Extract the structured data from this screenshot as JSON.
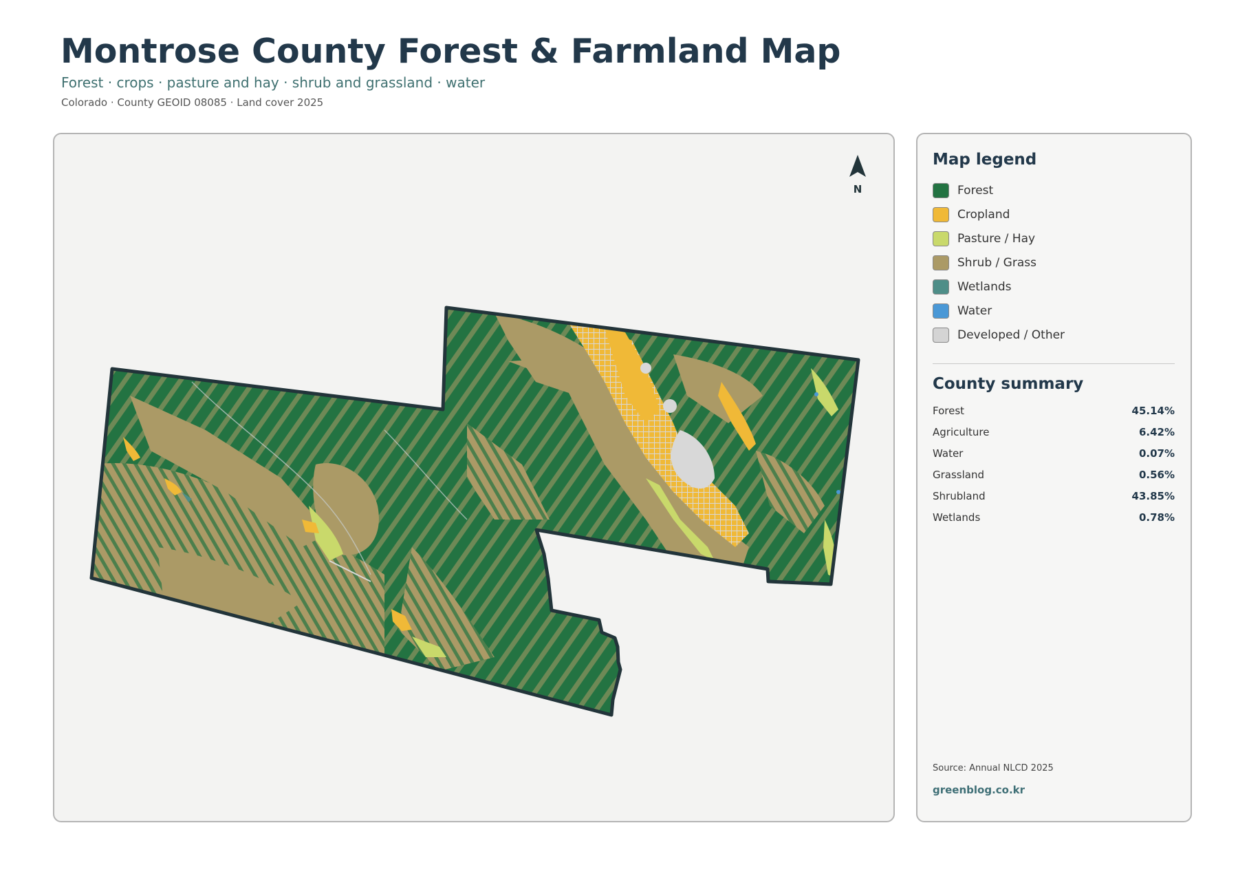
{
  "header": {
    "title": "Montrose County Forest & Farmland Map",
    "subtitle": "Forest · crops · pasture and hay · shrub and grassland · water",
    "meta": "Colorado · County GEOID 08085 · Land cover 2025"
  },
  "map": {
    "north_label": "N",
    "colors": {
      "forest": "#237342",
      "cropland": "#f0b937",
      "pasture": "#c9d96b",
      "shrub": "#ab9a66",
      "wetlands": "#4e8e88",
      "water": "#4a98d6",
      "developed": "#d8d8d8",
      "outline": "#22343a"
    }
  },
  "legend": {
    "title": "Map legend",
    "items": [
      {
        "label": "Forest",
        "color": "#237342"
      },
      {
        "label": "Cropland",
        "color": "#f0b937"
      },
      {
        "label": "Pasture / Hay",
        "color": "#c9d96b"
      },
      {
        "label": "Shrub / Grass",
        "color": "#ab9a66"
      },
      {
        "label": "Wetlands",
        "color": "#4e8e88"
      },
      {
        "label": "Water",
        "color": "#4a98d6"
      },
      {
        "label": "Developed / Other",
        "color": "#d4d4d4"
      }
    ]
  },
  "summary": {
    "title": "County summary",
    "rows": [
      {
        "name": "Forest",
        "value": "45.14%"
      },
      {
        "name": "Agriculture",
        "value": "6.42%"
      },
      {
        "name": "Water",
        "value": "0.07%"
      },
      {
        "name": "Grassland",
        "value": "0.56%"
      },
      {
        "name": "Shrubland",
        "value": "43.85%"
      },
      {
        "name": "Wetlands",
        "value": "0.78%"
      }
    ]
  },
  "footer": {
    "source": "Source: Annual NLCD 2025",
    "site": "greenblog.co.kr"
  }
}
